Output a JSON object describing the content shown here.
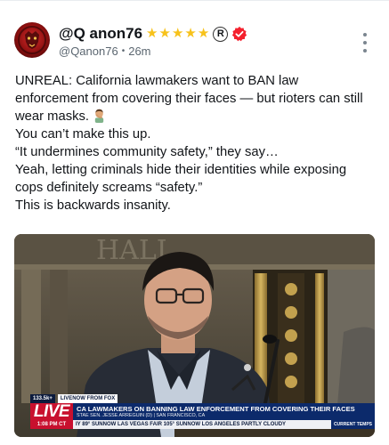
{
  "post": {
    "author": {
      "display_name": "@Q anon76",
      "stars": [
        "★",
        "★",
        "★",
        "★",
        "★"
      ],
      "registered_mark": "R",
      "handle": "@Qanon76",
      "separator": "•",
      "time": "26m"
    },
    "body_lines": [
      "UNREAL: California lawmakers want to BAN law enforcement from covering their faces — but rioters can still wear masks.",
      "You can’t make this up.",
      "“It undermines community safety,” they say…",
      "Yeah, letting criminals hide their identities while exposing cops definitely screams “safety.”",
      "This is backwards insanity."
    ],
    "emoji": "man-facepalming-emoji",
    "media": {
      "lower_third": {
        "viewers": "133.5k+",
        "live_now": "LIVENOW FROM FOX",
        "live_label": "LIVE",
        "headline": "CA LAWMAKERS ON BANNING LAW ENFORCEMENT FROM COVERING THEIR FACES",
        "subheadline": "STAE SEN. JESSE ARREGUIN (D) | SAN FRANCISCO, CA",
        "time": "1:08 PM CT",
        "ticker": "IY 89°  SUNNOW  LAS VEGAS  FAIR 105°  SUNNOW  LOS ANGELES  PARTLY CLOUDY",
        "current_temps": "CURRENT TEMPS"
      }
    }
  },
  "colors": {
    "text": "#111418",
    "muted": "#5b6670",
    "star": "#f7c21b",
    "verified": "#f4212e",
    "live_red": "#c8102e",
    "fox_navy": "#0c2a6b"
  }
}
